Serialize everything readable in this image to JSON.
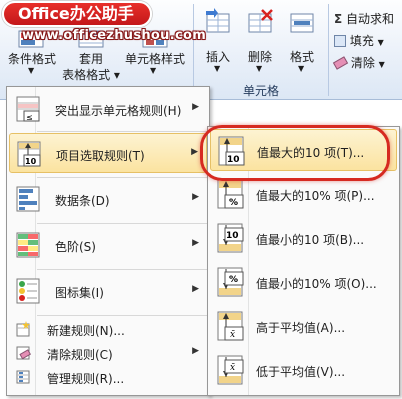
{
  "banner": {
    "title": "Office办公助手",
    "url": "www.officezhushou.com"
  },
  "ribbon": {
    "conditional_format": "条件格式",
    "format_as_table_line1": "套用",
    "format_as_table_line2": "表格格式",
    "cell_styles": "单元格样式",
    "insert": "插入",
    "delete": "删除",
    "format": "格式",
    "cells_group": "单元格",
    "autosum": "自动求和",
    "fill": "填充",
    "clear": "清除"
  },
  "menu": {
    "items": [
      {
        "label": "突出显示单元格规则(H)",
        "icon": "highlight-cells-rules-icon"
      },
      {
        "label": "项目选取规则(T)",
        "icon": "top-bottom-rules-icon"
      },
      {
        "label": "数据条(D)",
        "icon": "data-bars-icon"
      },
      {
        "label": "色阶(S)",
        "icon": "color-scales-icon"
      },
      {
        "label": "图标集(I)",
        "icon": "icon-sets-icon"
      }
    ],
    "small_items": [
      {
        "label": "新建规则(N)...",
        "icon": "new-rule-icon"
      },
      {
        "label": "清除规则(C)",
        "icon": "clear-rules-icon"
      },
      {
        "label": "管理规则(R)...",
        "icon": "manage-rules-icon"
      }
    ]
  },
  "submenu": {
    "items": [
      {
        "label": "值最大的10 项(T)...",
        "badge": "10"
      },
      {
        "label": "值最大的10% 项(P)...",
        "badge": "%"
      },
      {
        "label": "值最小的10 项(B)...",
        "badge": "10"
      },
      {
        "label": "值最小的10% 项(O)...",
        "badge": "%"
      },
      {
        "label": "高于平均值(A)...",
        "badge": "x̄"
      },
      {
        "label": "低于平均值(V)...",
        "badge": "x̄"
      }
    ]
  },
  "colors": {
    "accent_ring": "#d62a21",
    "hover_fill": "#fbe3a0",
    "banner_red": "#d8221f"
  }
}
